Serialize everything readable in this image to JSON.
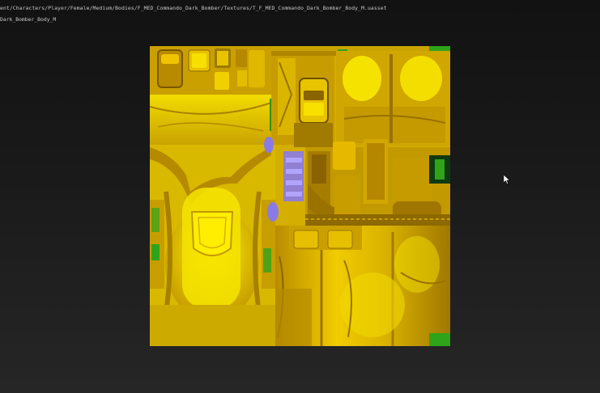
{
  "asset": {
    "path": "ent/Characters/Player/Female/Medium/Bodies/F_MED_Commando_Dark_Bomber/Textures/T_F_MED_Commando_Dark_Bomber_Body_M.uasset",
    "name": "Dark_Bomber_Body_M"
  },
  "viewer": {
    "texture_colors": {
      "base": "#d8b400",
      "highlight": "#f5e000",
      "shadow": "#8a6500",
      "green": "#2fa41a",
      "purple": "#8a7ae8"
    },
    "cursor_icon": "mouse-pointer-icon"
  }
}
